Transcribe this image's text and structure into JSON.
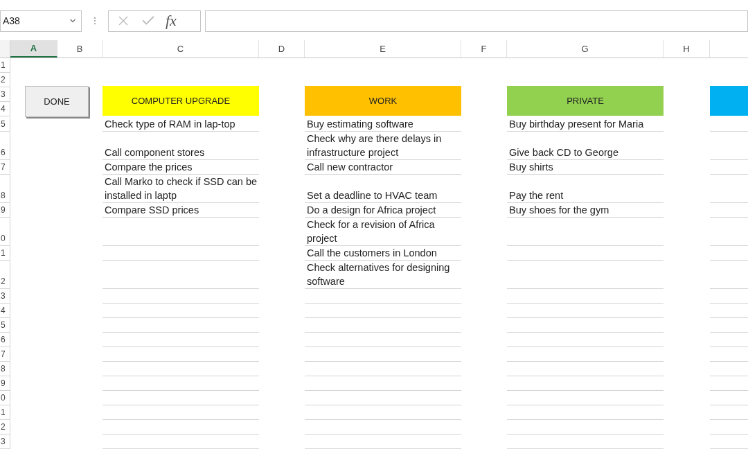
{
  "formula_bar": {
    "name_box": "A38",
    "function_label": "fx"
  },
  "columns": [
    {
      "label": "A",
      "selected": true
    },
    {
      "label": "B",
      "selected": false
    },
    {
      "label": "C",
      "selected": false
    },
    {
      "label": "D",
      "selected": false
    },
    {
      "label": "E",
      "selected": false
    },
    {
      "label": "F",
      "selected": false
    },
    {
      "label": "G",
      "selected": false
    },
    {
      "label": "H",
      "selected": false
    }
  ],
  "top_rows": [
    "1",
    "2",
    "3",
    "4"
  ],
  "done_button": "DONE",
  "categories": [
    {
      "title": "COMPUTER UPGRADE",
      "color": "#ffff00"
    },
    {
      "title": "WORK",
      "color": "#ffc000"
    },
    {
      "title": "PRIVATE",
      "color": "#92d050"
    },
    {
      "color": "#00b0f0"
    }
  ],
  "rows": [
    {
      "number": "5",
      "computer_upgrade": "Check type of RAM in lap-top",
      "work": "Buy estimating software",
      "private": "Buy birthday present for Maria"
    },
    {
      "number": "6",
      "computer_upgrade": "Call component stores",
      "work": "Check why are there delays in infrastructure project",
      "private": "Give back CD to George"
    },
    {
      "number": "7",
      "computer_upgrade": "Compare the prices",
      "work": "Call new contractor",
      "private": "Buy shirts"
    },
    {
      "number": "8",
      "computer_upgrade": "Call Marko to check if SSD can be installed in laptp",
      "work": "Set a deadline to HVAC team",
      "private": "Pay the rent"
    },
    {
      "number": "9",
      "computer_upgrade": "Compare SSD prices",
      "work": "Do a design for Africa project",
      "private": "Buy shoes for the gym"
    },
    {
      "number": "0",
      "work": "Check for a revision of Africa project"
    },
    {
      "number": "1",
      "work": "Call the customers in London"
    },
    {
      "number": "2",
      "work": "Check alternatives for designing software"
    },
    {
      "number": "3"
    },
    {
      "number": "4"
    },
    {
      "number": "5"
    },
    {
      "number": "6"
    },
    {
      "number": "7"
    },
    {
      "number": "8"
    },
    {
      "number": "9"
    },
    {
      "number": "0"
    },
    {
      "number": "1"
    },
    {
      "number": "2"
    },
    {
      "number": "3"
    }
  ]
}
